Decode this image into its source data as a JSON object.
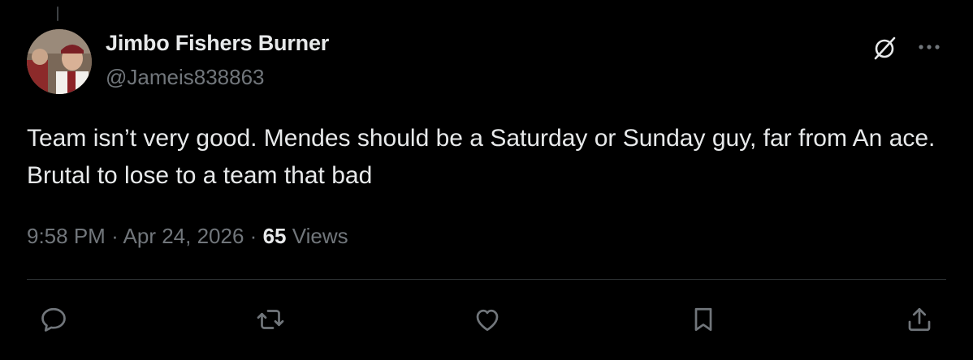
{
  "author": {
    "display_name": "Jimbo Fishers Burner",
    "handle": "@Jameis838863",
    "avatar": "avatar-photo"
  },
  "tweet": {
    "text": "Team isn’t very good. Mendes should be a Saturday or Sunday guy, far from An ace. Brutal to lose to a team that bad"
  },
  "meta": {
    "time": "9:58 PM",
    "separator": "·",
    "date": "Apr 24, 2026",
    "views_count": "65",
    "views_label": "Views"
  },
  "header_icons": [
    "grok-icon",
    "more-icon"
  ],
  "actions": [
    "reply-icon",
    "retweet-icon",
    "like-icon",
    "bookmark-icon",
    "share-icon"
  ],
  "colors": {
    "background": "#000000",
    "primary_text": "#e7e9ea",
    "secondary_text": "#71767b",
    "divider": "#2f3336"
  }
}
